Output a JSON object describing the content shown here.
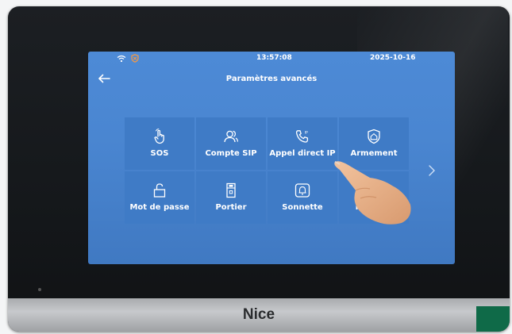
{
  "device": {
    "brand": "Nice"
  },
  "status_bar": {
    "time": "13:57:08",
    "date": "2025-10-16",
    "icons": [
      "wifi-icon",
      "shield-icon"
    ]
  },
  "header": {
    "back_icon": "back-arrow-icon",
    "title": "Paramètres avancés"
  },
  "grid": {
    "tiles": [
      {
        "label": "SOS",
        "icon": "touch-hand-icon"
      },
      {
        "label": "Compte SIP",
        "icon": "contacts-icon"
      },
      {
        "label": "Appel direct IP",
        "icon": "ip-call-icon"
      },
      {
        "label": "Armement",
        "icon": "home-shield-icon"
      },
      {
        "label": "Mot de passe",
        "icon": "lock-icon"
      },
      {
        "label": "Portier",
        "icon": "door-station-icon"
      },
      {
        "label": "Sonnette",
        "icon": "bell-icon"
      },
      {
        "label": "Réinitial",
        "icon": "reset-icon"
      }
    ],
    "next_icon": "chevron-right-icon"
  },
  "colors": {
    "screen_bg": "#4a86d1",
    "tile_bg": "#3f7bc6",
    "bezel": "#1a1d20",
    "bottom_bar": "#b7b9bc",
    "accent_green": "#0f6a48"
  }
}
